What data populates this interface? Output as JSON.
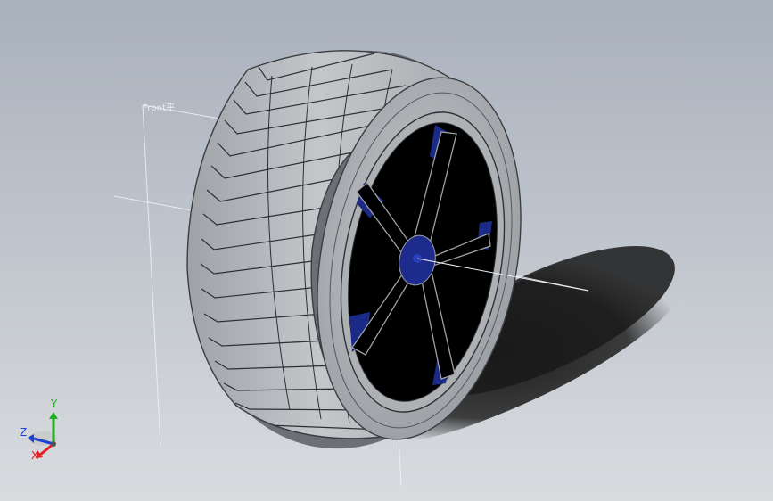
{
  "viewport": {
    "plane_label": "Front平"
  },
  "triad": {
    "x_label": "X",
    "y_label": "Y",
    "z_label": "Z",
    "x_color": "#e02020",
    "y_color": "#22b022",
    "z_color": "#2040d0"
  },
  "model": {
    "tire_color": "#b9bcbf",
    "rim_color": "#a9acaf",
    "spoke_color": "#000000",
    "hub_accent_color": "#1a2a8a",
    "shadow_color": "#1c1c1c"
  }
}
